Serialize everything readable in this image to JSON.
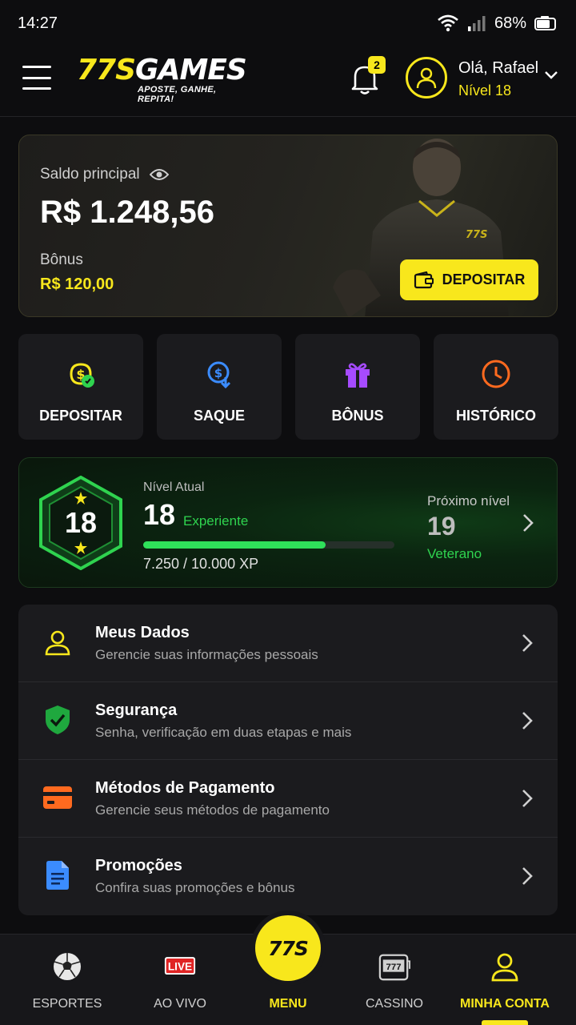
{
  "status_bar": {
    "time": "14:27",
    "battery": "68%"
  },
  "header": {
    "logo_main": "77S",
    "logo_games": "GAMES",
    "logo_tagline": "APOSTE, GANHE, REPITA!",
    "notifications_count": "2",
    "greeting": "Olá, Rafael",
    "level": "Nível 18"
  },
  "balance": {
    "label": "Saldo principal",
    "value": "R$ 1.248,56",
    "bonus_label": "Bônus",
    "bonus_value": "R$ 120,00",
    "deposit_label": "DEPOSITAR"
  },
  "quick_actions": [
    {
      "label": "DEPOSITAR",
      "icon": "money-deposit-icon",
      "color": "#f8e71c"
    },
    {
      "label": "SAQUE",
      "icon": "withdraw-icon",
      "color": "#3b8cff"
    },
    {
      "label": "BÔNUS",
      "icon": "gift-icon",
      "color": "#a64bff"
    },
    {
      "label": "HISTÓRICO",
      "icon": "clock-icon",
      "color": "#ff6a1f"
    }
  ],
  "level_card": {
    "badge_level": "18",
    "current_caption": "Nível Atual",
    "current_level": "18",
    "current_tag": "Experiente",
    "xp_text": "7.250 / 10.000 XP",
    "xp_fraction": 0.725,
    "next_caption": "Próximo nível",
    "next_level": "19",
    "next_tag": "Veterano"
  },
  "menu_items": [
    {
      "title": "Meus Dados",
      "subtitle": "Gerencie suas informações pessoais",
      "icon": "user-icon"
    },
    {
      "title": "Segurança",
      "subtitle": "Senha, verificação em duas etapas e mais",
      "icon": "shield-check-icon"
    },
    {
      "title": "Métodos de Pagamento",
      "subtitle": "Gerencie seus métodos de pagamento",
      "icon": "credit-card-icon"
    },
    {
      "title": "Promoções",
      "subtitle": "Confira suas promoções e bônus",
      "icon": "document-icon"
    }
  ],
  "bottom_nav": {
    "items": [
      {
        "label": "ESPORTES",
        "icon": "soccer-ball-icon"
      },
      {
        "label": "AO VIVO",
        "icon": "live-icon",
        "icon_text": "LIVE"
      },
      {
        "label": "MENU",
        "icon": "logo-icon",
        "icon_text": "77S"
      },
      {
        "label": "CASSINO",
        "icon": "slot-machine-icon",
        "icon_text": "777"
      },
      {
        "label": "MINHA CONTA",
        "icon": "user-icon"
      }
    ],
    "active": "MINHA CONTA"
  },
  "colors": {
    "accent": "#f8e71c",
    "green": "#2fd34f",
    "background": "#0d0d0f",
    "card": "#1b1b1e"
  }
}
